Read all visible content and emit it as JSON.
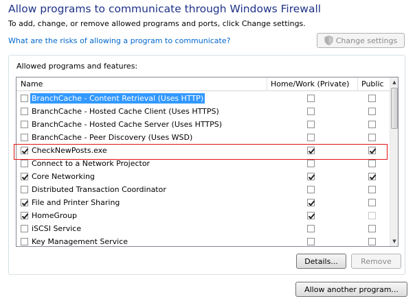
{
  "header": {
    "title": "Allow programs to communicate through Windows Firewall",
    "subtitle": "To add, change, or remove allowed programs and ports, click Change settings.",
    "risk_link": "What are the risks of allowing a program to communicate?",
    "change_settings_label": "Change settings"
  },
  "group": {
    "label": "Allowed programs and features:",
    "columns": {
      "name": "Name",
      "home": "Home/Work (Private)",
      "public": "Public"
    },
    "rows": [
      {
        "name": "BranchCache - Content Retrieval (Uses HTTP)",
        "enabled": false,
        "home": false,
        "public": false,
        "selected": true
      },
      {
        "name": "BranchCache - Hosted Cache Client (Uses HTTPS)",
        "enabled": false,
        "home": false,
        "public": false
      },
      {
        "name": "BranchCache - Hosted Cache Server (Uses HTTPS)",
        "enabled": false,
        "home": false,
        "public": false
      },
      {
        "name": "BranchCache - Peer Discovery (Uses WSD)",
        "enabled": false,
        "home": false,
        "public": false
      },
      {
        "name": "CheckNewPosts.exe",
        "enabled": true,
        "home": true,
        "public": true
      },
      {
        "name": "Connect to a Network Projector",
        "enabled": false,
        "home": false,
        "public": false
      },
      {
        "name": "Core Networking",
        "enabled": true,
        "home": true,
        "public": true
      },
      {
        "name": "Distributed Transaction Coordinator",
        "enabled": false,
        "home": false,
        "public": false
      },
      {
        "name": "File and Printer Sharing",
        "enabled": true,
        "home": true,
        "public": false
      },
      {
        "name": "HomeGroup",
        "enabled": true,
        "home": true,
        "public": false,
        "public_disabled": true
      },
      {
        "name": "iSCSI Service",
        "enabled": false,
        "home": false,
        "public": false
      },
      {
        "name": "Key Management Service",
        "enabled": false,
        "home": false,
        "public": false
      }
    ],
    "details_label": "Details...",
    "remove_label": "Remove"
  },
  "footer": {
    "allow_another_label": "Allow another program..."
  },
  "colors": {
    "title": "#1e3287",
    "link": "#0066cc",
    "selection": "#3399ff",
    "highlight_box": "#e01010"
  }
}
